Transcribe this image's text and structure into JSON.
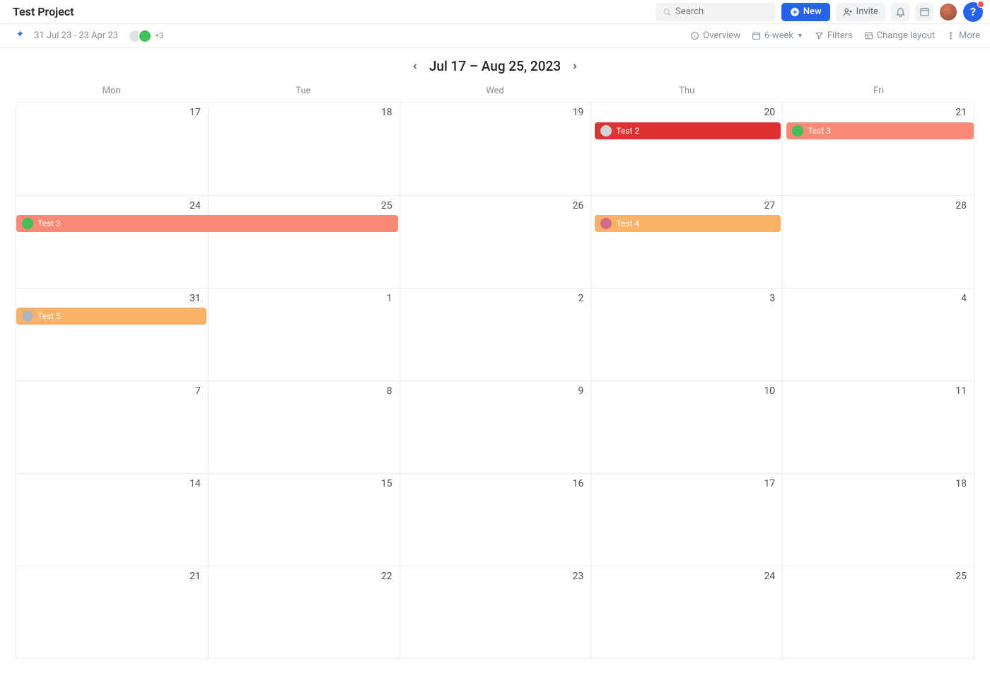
{
  "header": {
    "title": "Test Project",
    "search_placeholder": "Search",
    "new_label": "New",
    "invite_label": "Invite"
  },
  "subbar": {
    "date_range": "31 Jul 23 - 23 Apr 23",
    "avatar_more": "+3",
    "overview": "Overview",
    "range_select": "6-week",
    "filters": "Filters",
    "change_layout": "Change layout",
    "more": "More"
  },
  "datenav": {
    "title": "Jul 17 – Aug 25, 2023"
  },
  "days": [
    "Mon",
    "Tue",
    "Wed",
    "Thu",
    "Fri"
  ],
  "weeks": [
    {
      "dates": [
        "17",
        "18",
        "19",
        "20",
        "21"
      ],
      "events": [
        {
          "label": "Test 2",
          "colorClass": "ev-red",
          "avatarClass": "ava-gray",
          "startCol": 3,
          "spanCols": 1,
          "leftPad": 6,
          "rightPad": 2
        },
        {
          "label": "Test 3",
          "colorClass": "ev-coral",
          "avatarClass": "ava-green",
          "startCol": 4,
          "spanCols": 1,
          "leftPad": 6,
          "rightPad": 0
        }
      ]
    },
    {
      "dates": [
        "24",
        "25",
        "26",
        "27",
        "28"
      ],
      "events": [
        {
          "label": "Test 3",
          "colorClass": "ev-coral",
          "avatarClass": "ava-green",
          "startCol": 0,
          "spanCols": 2,
          "leftPad": 0,
          "rightPad": 2
        },
        {
          "label": "Test 4",
          "colorClass": "ev-orange",
          "avatarClass": "ava-pink",
          "startCol": 3,
          "spanCols": 1,
          "leftPad": 6,
          "rightPad": 2
        }
      ]
    },
    {
      "dates": [
        "31",
        "1",
        "2",
        "3",
        "4"
      ],
      "events": [
        {
          "label": "Test 5",
          "colorClass": "ev-orange",
          "avatarClass": "ava-lt",
          "startCol": 0,
          "spanCols": 1,
          "leftPad": 0,
          "rightPad": 2
        }
      ]
    },
    {
      "dates": [
        "7",
        "8",
        "9",
        "10",
        "11"
      ],
      "events": []
    },
    {
      "dates": [
        "14",
        "15",
        "16",
        "17",
        "18"
      ],
      "events": []
    },
    {
      "dates": [
        "21",
        "22",
        "23",
        "24",
        "25"
      ],
      "events": []
    }
  ]
}
